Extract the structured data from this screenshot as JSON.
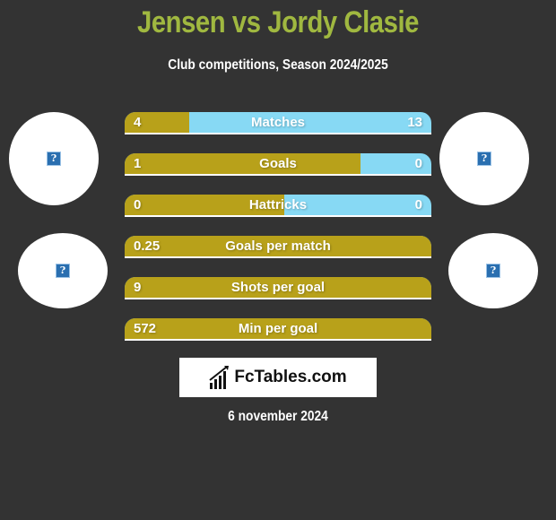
{
  "header": {
    "title": "Jensen vs Jordy Clasie",
    "subtitle": "Club competitions, Season 2024/2025"
  },
  "players": {
    "left_avatar_icon": "?",
    "right_avatar_icon": "?",
    "left_club_icon": "?",
    "right_club_icon": "?"
  },
  "colors": {
    "left_fill": "#b8a11a",
    "right_fill": "#87d9f4",
    "title": "#a0b840",
    "background": "#333333"
  },
  "stats": [
    {
      "label": "Matches",
      "left": "4",
      "right": "13",
      "left_share": 0.21
    },
    {
      "label": "Goals",
      "left": "1",
      "right": "0",
      "left_share": 0.77
    },
    {
      "label": "Hattricks",
      "left": "0",
      "right": "0",
      "left_share": 0.52
    },
    {
      "label": "Goals per match",
      "left": "0.25",
      "right": "",
      "left_share": 1.0
    },
    {
      "label": "Shots per goal",
      "left": "9",
      "right": "",
      "left_share": 1.0
    },
    {
      "label": "Min per goal",
      "left": "572",
      "right": "",
      "left_share": 1.0
    }
  ],
  "logo": {
    "text": "FcTables.com",
    "icon": "bar-chart-icon"
  },
  "date": "6 november 2024"
}
